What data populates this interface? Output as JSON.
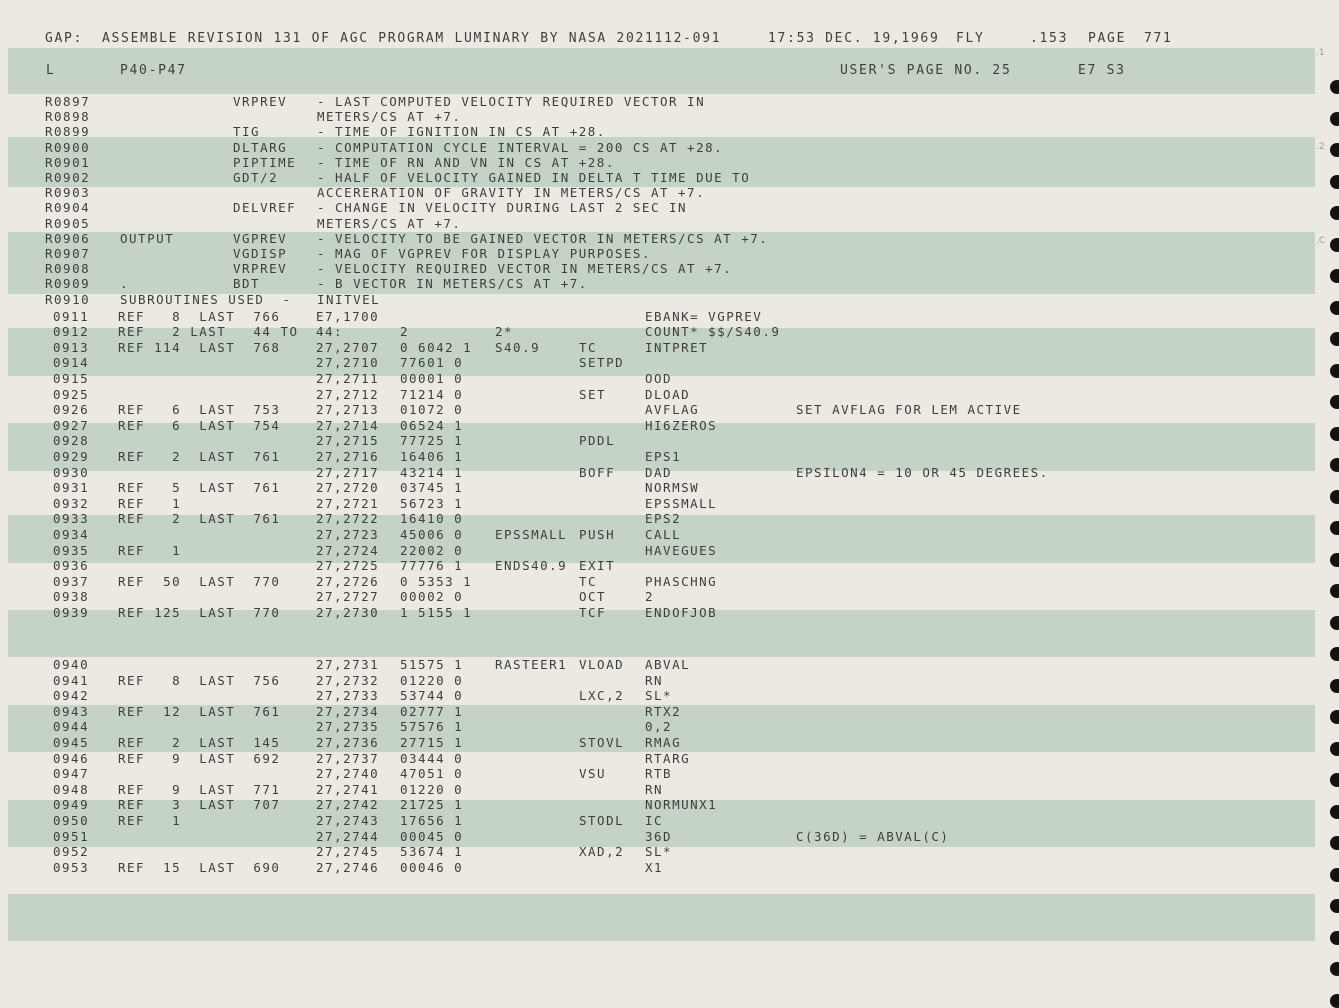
{
  "header": {
    "gap_label": "GAP:",
    "assemble_text": "ASSEMBLE REVISION 131 OF AGC PROGRAM LUMINARY BY NASA 2021112-091",
    "timestamp": "17:53 DEC. 19,1969",
    "mode": "FLY",
    "sheet": ".153",
    "page_label": "PAGE",
    "page_number": "771"
  },
  "subheader": {
    "left": "L",
    "section": "P40-P47",
    "users_page": "USER'S PAGE NO. 25",
    "code": "E7 S3"
  },
  "margin_marks": [
    ".1",
    ".2",
    ".C"
  ],
  "lines": [
    [
      "R0897",
      "",
      "VRPREV",
      "- LAST COMPUTED VELOCITY REQUIRED VECTOR IN"
    ],
    [
      "R0898",
      "",
      "",
      "METERS/CS AT +7."
    ],
    [
      "R0899",
      "",
      "TIG",
      "- TIME OF IGNITION IN CS AT +28."
    ],
    [
      "R0900",
      "",
      "DLTARG",
      "- COMPUTATION CYCLE INTERVAL = 200 CS AT +28."
    ],
    [
      "R0901",
      "",
      "PIPTIME",
      "- TIME OF RN AND VN IN CS AT +28."
    ],
    [
      "R0902",
      "",
      "GDT/2",
      "- HALF OF VELOCITY GAINED IN DELTA T TIME DUE TO"
    ],
    [
      "R0903",
      "",
      "",
      "ACCERERATION OF GRAVITY IN METERS/CS AT +7."
    ],
    [
      "R0904",
      "",
      "DELVREF",
      "- CHANGE IN VELOCITY DURING LAST 2 SEC IN"
    ],
    [
      "R0905",
      "",
      "",
      "METERS/CS AT +7."
    ],
    [
      "R0906",
      "OUTPUT",
      "VGPREV",
      "- VELOCITY TO BE GAINED VECTOR IN METERS/CS AT +7."
    ],
    [
      "R0907",
      "",
      "VGDISP",
      "- MAG OF VGPREV FOR DISPLAY PURPOSES."
    ],
    [
      "R0908",
      "",
      "VRPREV",
      "- VELOCITY REQUIRED VECTOR IN METERS/CS AT +7."
    ],
    [
      "R0909",
      ".",
      "BDT",
      "- B VECTOR IN METERS/CS AT +7."
    ],
    [
      "R0910",
      "SUBROUTINES USED  -",
      "",
      "INITVEL"
    ]
  ],
  "code_lines": [
    [
      "0911",
      "REF   8  LAST  766",
      "E7,1700",
      "",
      "",
      "",
      "EBANK= VGPREV",
      ""
    ],
    [
      "0912",
      "REF   2 LAST   44 TO",
      "44:",
      "2",
      "2*",
      "",
      "COUNT* $$/S40.9",
      ""
    ],
    [
      "0913",
      "REF 114  LAST  768",
      "27,2707",
      "0 6042 1",
      "S40.9",
      "TC",
      "INTPRET",
      ""
    ],
    [
      "0914",
      "",
      "27,2710",
      "77601 0",
      "",
      "SETPD",
      "",
      ""
    ],
    [
      "0915",
      "",
      "27,2711",
      "00001 0",
      "",
      "",
      "OOD",
      ""
    ],
    [
      "0925",
      "",
      "27,2712",
      "71214 0",
      "",
      "SET",
      "DLOAD",
      ""
    ],
    [
      "0926",
      "REF   6  LAST  753",
      "27,2713",
      "01072 0",
      "",
      "",
      "AVFLAG",
      "SET AVFLAG FOR LEM ACTIVE"
    ],
    [
      "0927",
      "REF   6  LAST  754",
      "27,2714",
      "06524 1",
      "",
      "",
      "HI6ZEROS",
      ""
    ],
    [
      "0928",
      "",
      "27,2715",
      "77725 1",
      "",
      "PDDL",
      "",
      ""
    ],
    [
      "0929",
      "REF   2  LAST  761",
      "27,2716",
      "16406 1",
      "",
      "",
      "EPS1",
      ""
    ],
    [
      "0930",
      "",
      "27,2717",
      "43214 1",
      "",
      "BOFF",
      "DAD",
      "EPSILON4 = 10 OR 45 DEGREES."
    ],
    [
      "0931",
      "REF   5  LAST  761",
      "27,2720",
      "03745 1",
      "",
      "",
      "NORMSW",
      ""
    ],
    [
      "0932",
      "REF   1",
      "27,2721",
      "56723 1",
      "",
      "",
      "EPSSMALL",
      ""
    ],
    [
      "0933",
      "REF   2  LAST  761",
      "27,2722",
      "16410 0",
      "",
      "",
      "EPS2",
      ""
    ],
    [
      "0934",
      "",
      "27,2723",
      "45006 0",
      "EPSSMALL",
      "PUSH",
      "CALL",
      ""
    ],
    [
      "0935",
      "REF   1",
      "27,2724",
      "22002 0",
      "",
      "",
      "HAVEGUES",
      ""
    ],
    [
      "0936",
      "",
      "27,2725",
      "77776 1",
      "ENDS40.9",
      "EXIT",
      "",
      ""
    ],
    [
      "0937",
      "REF  50  LAST  770",
      "27,2726",
      "0 5353 1",
      "",
      "TC",
      "PHASCHNG",
      ""
    ],
    [
      "0938",
      "",
      "27,2727",
      "00002 0",
      "",
      "OCT",
      "2",
      ""
    ],
    [
      "0939",
      "REF 125  LAST  770",
      "27,2730",
      "1 5155 1",
      "",
      "TCF",
      "ENDOFJOB",
      ""
    ],
    [
      "0940",
      "",
      "27,2731",
      "51575 1",
      "RASTEER1",
      "VLOAD",
      "ABVAL",
      ""
    ],
    [
      "0941",
      "REF   8  LAST  756",
      "27,2732",
      "01220 0",
      "",
      "",
      "RN",
      ""
    ],
    [
      "0942",
      "",
      "27,2733",
      "53744 0",
      "",
      "LXC,2",
      "SL*",
      ""
    ],
    [
      "0943",
      "REF  12  LAST  761",
      "27,2734",
      "02777 1",
      "",
      "",
      "RTX2",
      ""
    ],
    [
      "0944",
      "",
      "27,2735",
      "57576 1",
      "",
      "",
      "0,2",
      ""
    ],
    [
      "0945",
      "REF   2  LAST  145",
      "27,2736",
      "27715 1",
      "",
      "STOVL",
      "RMAG",
      ""
    ],
    [
      "0946",
      "REF   9  LAST  692",
      "27,2737",
      "03444 0",
      "",
      "",
      "RTARG",
      ""
    ],
    [
      "0947",
      "",
      "27,2740",
      "47051 0",
      "",
      "VSU",
      "RTB",
      ""
    ],
    [
      "0948",
      "REF   9  LAST  771",
      "27,2741",
      "01220 0",
      "",
      "",
      "RN",
      ""
    ],
    [
      "0949",
      "REF   3  LAST  707",
      "27,2742",
      "21725 1",
      "",
      "",
      "NORMUNX1",
      ""
    ],
    [
      "0950",
      "REF   1",
      "27,2743",
      "17656 1",
      "",
      "STODL",
      "IC",
      ""
    ],
    [
      "0951",
      "",
      "27,2744",
      "00045 0",
      "",
      "",
      "36D",
      "C(36D) = ABVAL(C)"
    ],
    [
      "0952",
      "",
      "27,2745",
      "53674 1",
      "",
      "XAD,2",
      "SL*",
      ""
    ],
    [
      "0953",
      "REF  15  LAST  690",
      "27,2746",
      "00046 0",
      "",
      "",
      "X1",
      ""
    ]
  ]
}
